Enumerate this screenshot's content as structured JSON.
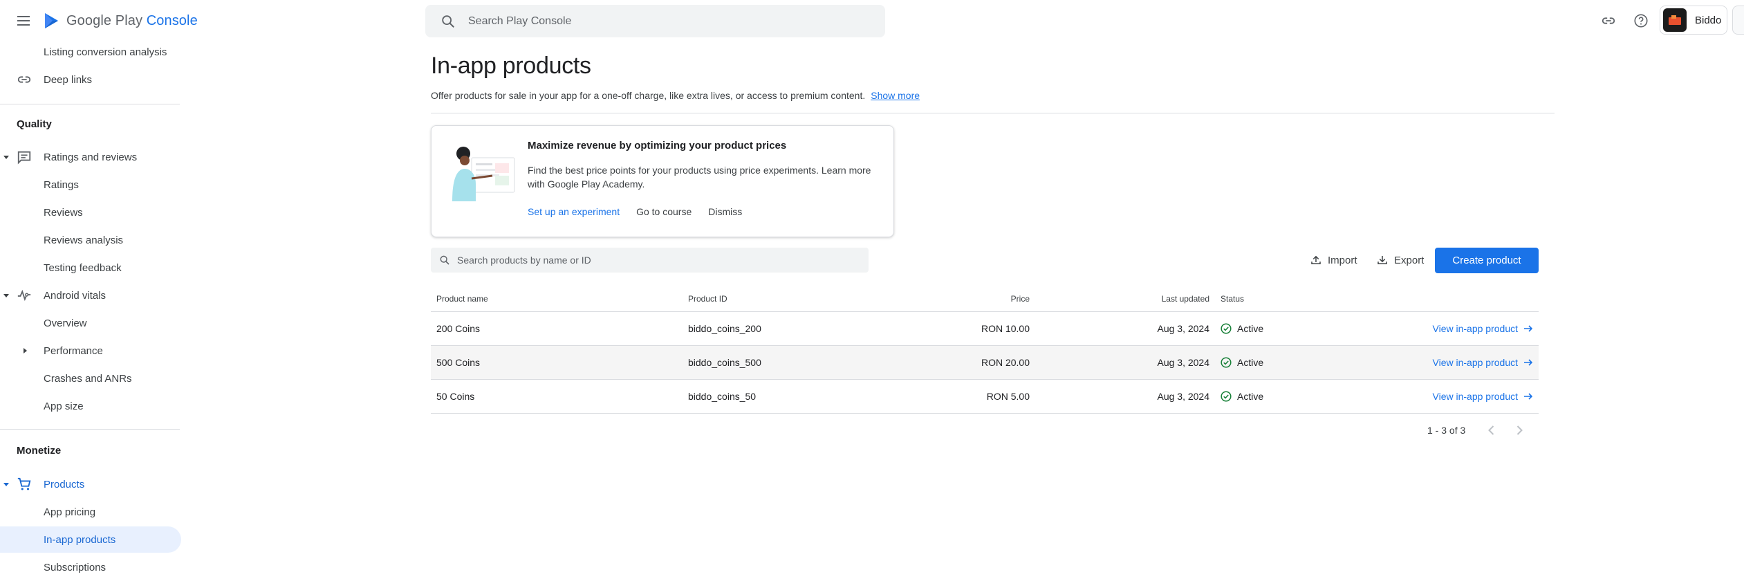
{
  "header": {
    "logo_text_main": "Google Play ",
    "logo_text_accent": "Console",
    "search_placeholder": "Search Play Console",
    "app_name": "Biddo"
  },
  "sidebar": {
    "items_top": [
      {
        "label": "Listing conversion analysis"
      },
      {
        "label": "Deep links"
      }
    ],
    "quality_header": "Quality",
    "quality_items": [
      {
        "label": "Ratings and reviews"
      },
      {
        "label": "Ratings"
      },
      {
        "label": "Reviews"
      },
      {
        "label": "Reviews analysis"
      },
      {
        "label": "Testing feedback"
      },
      {
        "label": "Android vitals"
      },
      {
        "label": "Overview"
      },
      {
        "label": "Performance"
      },
      {
        "label": "Crashes and ANRs"
      },
      {
        "label": "App size"
      }
    ],
    "monetize_header": "Monetize",
    "monetize_items": [
      {
        "label": "Products"
      },
      {
        "label": "App pricing"
      },
      {
        "label": "In-app products"
      },
      {
        "label": "Subscriptions"
      }
    ]
  },
  "main": {
    "title": "In-app products",
    "description": "Offer products for sale in your app for a one-off charge, like extra lives, or access to premium content.",
    "show_more": "Show more",
    "promo": {
      "title": "Maximize revenue by optimizing your product prices",
      "body": "Find the best price points for your products using price experiments. Learn more with Google Play Academy.",
      "action_primary": "Set up an experiment",
      "action_course": "Go to course",
      "action_dismiss": "Dismiss"
    },
    "search_placeholder": "Search products by name or ID",
    "import_label": "Import",
    "export_label": "Export",
    "create_label": "Create product",
    "table": {
      "headers": [
        "Product name",
        "Product ID",
        "Price",
        "Last updated",
        "Status"
      ],
      "rows": [
        {
          "name": "200 Coins",
          "id": "biddo_coins_200",
          "price": "RON 10.00",
          "updated": "Aug 3, 2024",
          "status": "Active",
          "link": "View in-app product"
        },
        {
          "name": "500 Coins",
          "id": "biddo_coins_500",
          "price": "RON 20.00",
          "updated": "Aug 3, 2024",
          "status": "Active",
          "link": "View in-app product"
        },
        {
          "name": "50 Coins",
          "id": "biddo_coins_50",
          "price": "RON 5.00",
          "updated": "Aug 3, 2024",
          "status": "Active",
          "link": "View in-app product"
        }
      ]
    },
    "pagination": "1 - 3 of 3"
  },
  "colors": {
    "accent": "#1a73e8",
    "active_nav_bg": "#e8f0fe",
    "status_green": "#188038"
  },
  "icons": [
    "menu-icon",
    "play-console-logo",
    "search-icon",
    "link-icon",
    "help-icon",
    "app-icon",
    "deep-link-icon",
    "reviews-icon",
    "vitals-icon",
    "cart-icon",
    "upload-icon",
    "download-icon",
    "check-circle-icon",
    "arrow-right-icon",
    "chevron-left-icon",
    "chevron-right-icon"
  ]
}
